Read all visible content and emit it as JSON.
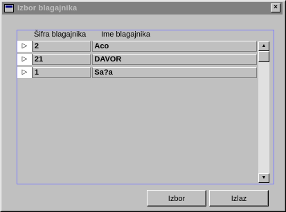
{
  "window": {
    "title": "Izbor blagajnika",
    "close_glyph": "×"
  },
  "grid": {
    "columns": [
      "Šifra blagajnika",
      "Ime blagajnika"
    ],
    "rows": [
      {
        "indicator": "▷",
        "code": "2",
        "name": "Aco"
      },
      {
        "indicator": "▷",
        "code": "21",
        "name": "DAVOR"
      },
      {
        "indicator": "▷",
        "code": "1",
        "name": "Sa?a"
      }
    ]
  },
  "scrollbar": {
    "up_glyph": "▲",
    "down_glyph": "▼"
  },
  "buttons": {
    "select_label": "Izbor",
    "exit_label": "Izlaz"
  }
}
